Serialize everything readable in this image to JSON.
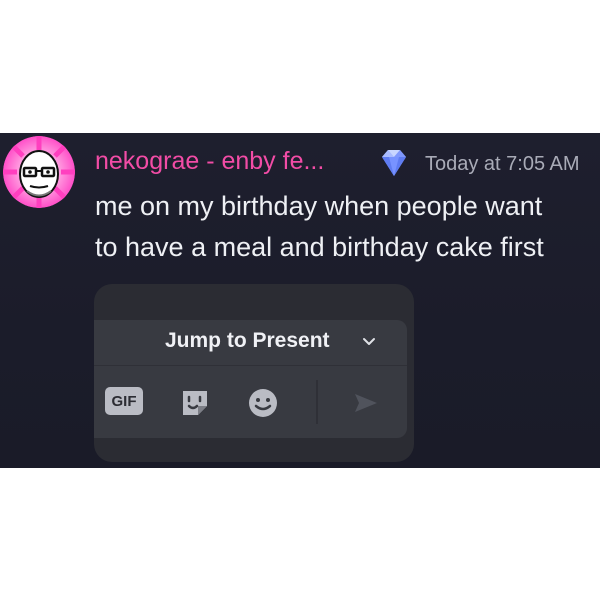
{
  "message": {
    "author": "nekograe - enby fe...",
    "timestamp": "Today at 7:05 AM",
    "text_lines": [
      "me on my birthday when people want",
      "to have a meal and birthday cake first"
    ]
  },
  "embed": {
    "jump_label": "Jump to Present",
    "gif_label": "GIF"
  },
  "icons": {
    "badge": "gem-icon",
    "jump_arrow": "chevron-down-icon",
    "sticker": "sticker-icon",
    "emoji": "emoji-icon",
    "send": "send-icon"
  },
  "colors": {
    "author": "#f24ca6",
    "background": "#1e1f2e",
    "text": "#eef0f4",
    "timestamp": "#a9abb7"
  }
}
